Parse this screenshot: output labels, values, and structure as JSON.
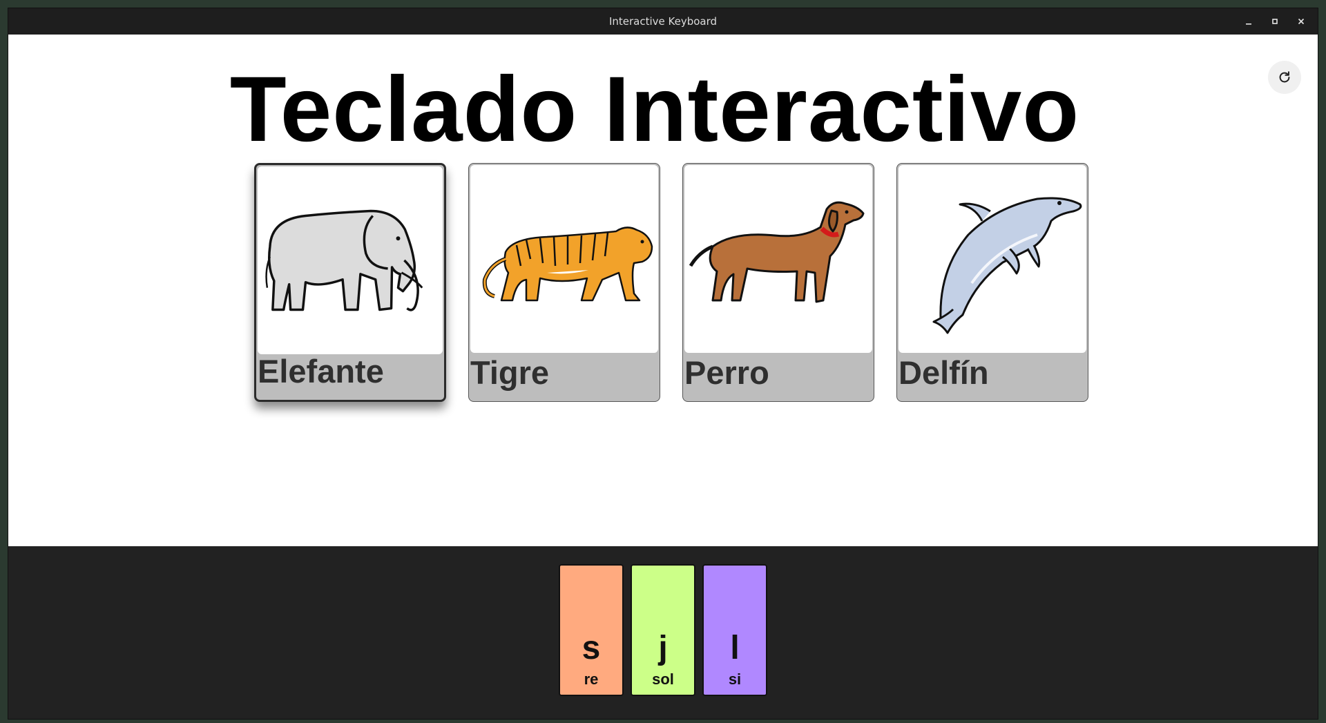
{
  "window": {
    "title": "Interactive Keyboard",
    "controls": [
      "minimize-icon",
      "maximize-icon",
      "close-icon"
    ]
  },
  "page": {
    "heading": "Teclado Interactivo",
    "refresh_icon": "refresh-icon"
  },
  "cards": [
    {
      "label": "Elefante",
      "icon": "elephant-image",
      "selected": true
    },
    {
      "label": "Tigre",
      "icon": "tiger-image",
      "selected": false
    },
    {
      "label": "Perro",
      "icon": "dog-image",
      "selected": false
    },
    {
      "label": "Delfín",
      "icon": "dolphin-image",
      "selected": false
    }
  ],
  "keys": [
    {
      "letter": "s",
      "note": "re",
      "color": "#ffaa7f"
    },
    {
      "letter": "j",
      "note": "sol",
      "color": "#ccff88"
    },
    {
      "letter": "l",
      "note": "si",
      "color": "#b088ff"
    }
  ],
  "colors": {
    "card_label_bg": "#bdbdbd",
    "keyboard_bg": "#222222"
  }
}
